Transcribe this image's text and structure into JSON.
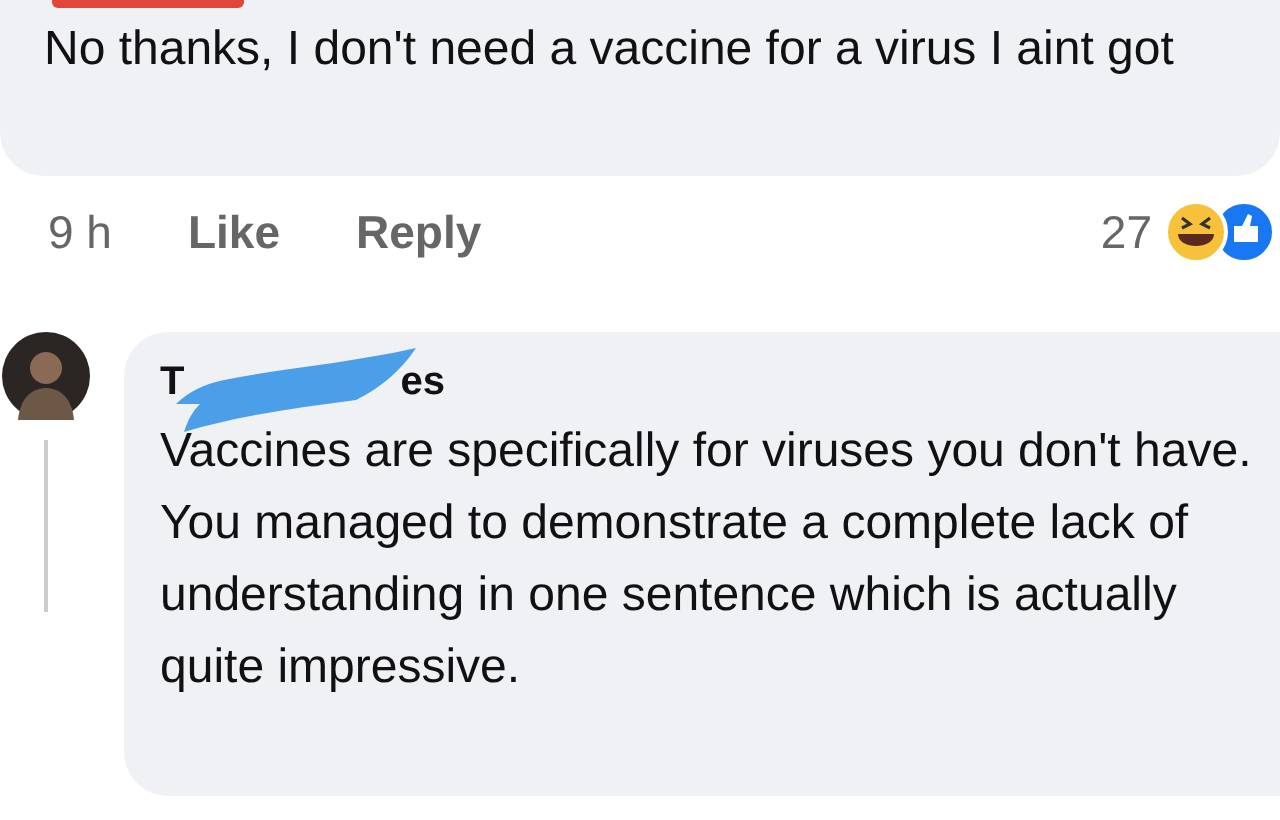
{
  "comment": {
    "text": "No thanks, I don't need a vaccine for a virus I aint got",
    "time": "9 h",
    "actions": [
      "Like",
      "Reply"
    ],
    "reaction_count": "27"
  },
  "reply": {
    "author_start": "T",
    "author_end": "es",
    "text": "Vaccines are specifically for viruses you don't have. You managed to demonstrate a complete lack of understanding in one sentence which is actually quite impressive."
  }
}
